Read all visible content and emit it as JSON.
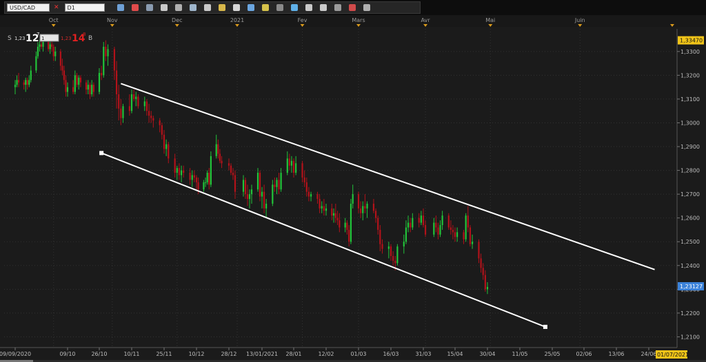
{
  "toolbar": {
    "symbol": "USD/CAD",
    "timeframe": "D1",
    "icon_names": [
      "close-icon",
      "x-icon",
      "bid-icon",
      "ask-icon",
      "cursor-icon",
      "crosshair-icon",
      "zoom-in-icon",
      "zoom-out-icon",
      "pan-icon",
      "point-icon",
      "text-icon",
      "eye-icon",
      "globe-icon",
      "pencil-icon",
      "chart-icon",
      "indicator-icon",
      "properties-icon",
      "template-icon",
      "alert-icon",
      "print-icon",
      "camera-icon",
      "export-icon",
      "settings-icon"
    ]
  },
  "trade_panel": {
    "sell_label": "S",
    "sell_price_small": "1,23",
    "sell_price_big": "12",
    "sell_price_sup": "7",
    "qty": "1",
    "buy_price_small": "1,23",
    "buy_price_big": "14",
    "buy_price_sup": "8",
    "buy_label": "B"
  },
  "colors": {
    "bull": "#22c43a",
    "bear": "#b3121a",
    "background": "#1b1b1b",
    "trendline": "#ffffff",
    "price_tag_current": "#3b82d9",
    "price_tag_top": "#f0c419"
  },
  "chart_data": {
    "type": "candlestick",
    "symbol": "USD/CAD",
    "timeframe": "D1",
    "y_range": [
      1.2055,
      1.3395
    ],
    "y_ticks": [
      "1,3300",
      "1,3200",
      "1,3100",
      "1,3000",
      "1,2900",
      "1,2800",
      "1,2700",
      "1,2600",
      "1,2500",
      "1,2400",
      "1,2300",
      "1,2200",
      "1,2100"
    ],
    "y_tick_values": [
      1.33,
      1.32,
      1.31,
      1.3,
      1.29,
      1.28,
      1.27,
      1.26,
      1.25,
      1.24,
      1.23,
      1.22,
      1.21
    ],
    "top_price_label": "1,33470",
    "top_price_value": 1.3347,
    "current_price_label": "1,23127",
    "current_price_value": 1.23127,
    "start_date": "09/09/2020",
    "end_date_label": "01/07/2021",
    "x_labels": [
      "09/09/2020",
      "09/10",
      "26/10",
      "10/11",
      "25/11",
      "10/12",
      "28/12",
      "13/01/2021",
      "28/01",
      "12/02",
      "01/03",
      "16/03",
      "31/03",
      "15/04",
      "30/04",
      "11/05",
      "25/05",
      "02/06",
      "13/06",
      "24/06"
    ],
    "x_label_dates": [
      "2020-09-09",
      "2020-10-09",
      "2020-10-26",
      "2020-11-10",
      "2020-11-25",
      "2020-12-10",
      "2020-12-28",
      "2021-01-13",
      "2021-01-28",
      "2021-02-12",
      "2021-03-01",
      "2021-03-16",
      "2021-03-31",
      "2021-04-15",
      "2021-04-30",
      "2021-05-11",
      "2021-05-25",
      "2021-06-02",
      "2021-06-13",
      "2021-06-24"
    ],
    "months": [
      "Oct",
      "Nov",
      "Dec",
      "2021",
      "Fev",
      "Mars",
      "Avr",
      "Mai",
      "Juin"
    ],
    "month_dates": [
      "2020-10-01",
      "2020-11-01",
      "2020-12-01",
      "2021-01-01",
      "2021-02-01",
      "2021-03-01",
      "2021-04-01",
      "2021-05-01",
      "2021-06-01"
    ],
    "candles": [
      [
        "2020-09-09",
        1.315,
        1.318,
        1.312,
        1.316
      ],
      [
        "2020-09-10",
        1.316,
        1.32,
        1.315,
        1.318
      ],
      [
        "2020-09-11",
        1.318,
        1.321,
        1.315,
        1.317
      ],
      [
        "2020-09-14",
        1.317,
        1.318,
        1.314,
        1.316
      ],
      [
        "2020-09-15",
        1.316,
        1.319,
        1.313,
        1.318
      ],
      [
        "2020-09-16",
        1.318,
        1.319,
        1.314,
        1.316
      ],
      [
        "2020-09-17",
        1.316,
        1.32,
        1.315,
        1.318
      ],
      [
        "2020-09-18",
        1.318,
        1.324,
        1.317,
        1.322
      ],
      [
        "2020-09-21",
        1.322,
        1.33,
        1.321,
        1.328
      ],
      [
        "2020-09-22",
        1.328,
        1.334,
        1.327,
        1.332
      ],
      [
        "2020-09-23",
        1.332,
        1.335,
        1.33,
        1.333
      ],
      [
        "2020-09-24",
        1.333,
        1.336,
        1.331,
        1.332
      ],
      [
        "2020-09-25",
        1.332,
        1.335,
        1.33,
        1.334
      ],
      [
        "2020-09-28",
        1.334,
        1.336,
        1.33,
        1.331
      ],
      [
        "2020-09-29",
        1.331,
        1.334,
        1.329,
        1.333
      ],
      [
        "2020-09-30",
        1.333,
        1.334,
        1.33,
        1.332
      ],
      [
        "2020-10-01",
        1.332,
        1.333,
        1.326,
        1.328
      ],
      [
        "2020-10-02",
        1.328,
        1.332,
        1.326,
        1.33
      ],
      [
        "2020-10-05",
        1.33,
        1.331,
        1.322,
        1.324
      ],
      [
        "2020-10-06",
        1.324,
        1.327,
        1.32,
        1.322
      ],
      [
        "2020-10-07",
        1.322,
        1.324,
        1.316,
        1.318
      ],
      [
        "2020-10-08",
        1.318,
        1.32,
        1.311,
        1.313
      ],
      [
        "2020-10-09",
        1.313,
        1.317,
        1.311,
        1.315
      ],
      [
        "2020-10-12",
        1.315,
        1.318,
        1.312,
        1.313
      ],
      [
        "2020-10-13",
        1.313,
        1.322,
        1.312,
        1.32
      ],
      [
        "2020-10-14",
        1.32,
        1.321,
        1.315,
        1.316
      ],
      [
        "2020-10-15",
        1.316,
        1.32,
        1.314,
        1.319
      ],
      [
        "2020-10-16",
        1.319,
        1.32,
        1.315,
        1.317
      ],
      [
        "2020-10-19",
        1.317,
        1.318,
        1.312,
        1.314
      ],
      [
        "2020-10-20",
        1.314,
        1.318,
        1.312,
        1.316
      ],
      [
        "2020-10-21",
        1.316,
        1.317,
        1.31,
        1.312
      ],
      [
        "2020-10-22",
        1.312,
        1.318,
        1.311,
        1.316
      ],
      [
        "2020-10-23",
        1.316,
        1.317,
        1.311,
        1.313
      ],
      [
        "2020-10-26",
        1.313,
        1.323,
        1.312,
        1.321
      ],
      [
        "2020-10-27",
        1.321,
        1.324,
        1.318,
        1.32
      ],
      [
        "2020-10-28",
        1.32,
        1.334,
        1.319,
        1.332
      ],
      [
        "2020-10-29",
        1.332,
        1.3347,
        1.326,
        1.328
      ],
      [
        "2020-10-30",
        1.328,
        1.333,
        1.324,
        1.331
      ],
      [
        "2020-11-02",
        1.331,
        1.332,
        1.318,
        1.322
      ],
      [
        "2020-11-03",
        1.322,
        1.326,
        1.306,
        1.312
      ],
      [
        "2020-11-04",
        1.312,
        1.316,
        1.301,
        1.306
      ],
      [
        "2020-11-05",
        1.306,
        1.31,
        1.299,
        1.302
      ],
      [
        "2020-11-06",
        1.302,
        1.308,
        1.3,
        1.307
      ],
      [
        "2020-11-09",
        1.307,
        1.312,
        1.303,
        1.305
      ],
      [
        "2020-11-10",
        1.305,
        1.314,
        1.304,
        1.312
      ],
      [
        "2020-11-11",
        1.312,
        1.314,
        1.309,
        1.31
      ],
      [
        "2020-11-12",
        1.31,
        1.313,
        1.307,
        1.311
      ],
      [
        "2020-11-13",
        1.311,
        1.312,
        1.306,
        1.307
      ],
      [
        "2020-11-16",
        1.307,
        1.311,
        1.305,
        1.309
      ],
      [
        "2020-11-17",
        1.309,
        1.31,
        1.303,
        1.305
      ],
      [
        "2020-11-18",
        1.305,
        1.308,
        1.3,
        1.303
      ],
      [
        "2020-11-19",
        1.303,
        1.305,
        1.3,
        1.302
      ],
      [
        "2020-11-20",
        1.302,
        1.303,
        1.298,
        1.301
      ],
      [
        "2020-11-23",
        1.301,
        1.302,
        1.296,
        1.299
      ],
      [
        "2020-11-24",
        1.299,
        1.3,
        1.293,
        1.295
      ],
      [
        "2020-11-25",
        1.295,
        1.297,
        1.287,
        1.289
      ],
      [
        "2020-11-26",
        1.289,
        1.293,
        1.286,
        1.291
      ],
      [
        "2020-11-27",
        1.291,
        1.292,
        1.283,
        1.285
      ],
      [
        "2020-11-30",
        1.285,
        1.287,
        1.277,
        1.279
      ],
      [
        "2020-12-01",
        1.279,
        1.282,
        1.276,
        1.281
      ],
      [
        "2020-12-02",
        1.281,
        1.283,
        1.276,
        1.278
      ],
      [
        "2020-12-03",
        1.278,
        1.282,
        1.275,
        1.28
      ],
      [
        "2020-12-04",
        1.28,
        1.282,
        1.277,
        1.279
      ],
      [
        "2020-12-07",
        1.279,
        1.281,
        1.274,
        1.276
      ],
      [
        "2020-12-08",
        1.276,
        1.28,
        1.273,
        1.278
      ],
      [
        "2020-12-09",
        1.278,
        1.28,
        1.275,
        1.277
      ],
      [
        "2020-12-10",
        1.277,
        1.278,
        1.272,
        1.275
      ],
      [
        "2020-12-11",
        1.275,
        1.277,
        1.27,
        1.272
      ],
      [
        "2020-12-14",
        1.272,
        1.276,
        1.271,
        1.275
      ],
      [
        "2020-12-15",
        1.275,
        1.277,
        1.273,
        1.275
      ],
      [
        "2020-12-16",
        1.275,
        1.28,
        1.274,
        1.279
      ],
      [
        "2020-12-17",
        1.279,
        1.281,
        1.272,
        1.274
      ],
      [
        "2020-12-18",
        1.274,
        1.288,
        1.273,
        1.286
      ],
      [
        "2020-12-21",
        1.286,
        1.295,
        1.285,
        1.291
      ],
      [
        "2020-12-22",
        1.291,
        1.293,
        1.285,
        1.287
      ],
      [
        "2020-12-23",
        1.287,
        1.289,
        1.283,
        1.284
      ],
      [
        "2020-12-24",
        1.284,
        1.286,
        1.281,
        1.283
      ],
      [
        "2020-12-28",
        1.283,
        1.285,
        1.28,
        1.282
      ],
      [
        "2020-12-29",
        1.282,
        1.283,
        1.278,
        1.279
      ],
      [
        "2020-12-30",
        1.279,
        1.281,
        1.276,
        1.278
      ],
      [
        "2020-12-31",
        1.278,
        1.28,
        1.268,
        1.271
      ],
      [
        "2021-01-04",
        1.271,
        1.278,
        1.269,
        1.276
      ],
      [
        "2021-01-05",
        1.276,
        1.277,
        1.268,
        1.27
      ],
      [
        "2021-01-06",
        1.27,
        1.274,
        1.265,
        1.268
      ],
      [
        "2021-01-07",
        1.268,
        1.272,
        1.264,
        1.27
      ],
      [
        "2021-01-08",
        1.27,
        1.274,
        1.266,
        1.272
      ],
      [
        "2021-01-11",
        1.272,
        1.281,
        1.271,
        1.279
      ],
      [
        "2021-01-12",
        1.279,
        1.28,
        1.267,
        1.269
      ],
      [
        "2021-01-13",
        1.269,
        1.273,
        1.264,
        1.271
      ],
      [
        "2021-01-14",
        1.271,
        1.274,
        1.262,
        1.264
      ],
      [
        "2021-01-15",
        1.264,
        1.268,
        1.26,
        1.266
      ],
      [
        "2021-01-18",
        1.266,
        1.276,
        1.265,
        1.274
      ],
      [
        "2021-01-19",
        1.274,
        1.277,
        1.271,
        1.273
      ],
      [
        "2021-01-20",
        1.273,
        1.277,
        1.27,
        1.276
      ],
      [
        "2021-01-21",
        1.276,
        1.279,
        1.27,
        1.272
      ],
      [
        "2021-01-22",
        1.272,
        1.281,
        1.271,
        1.279
      ],
      [
        "2021-01-25",
        1.279,
        1.288,
        1.278,
        1.285
      ],
      [
        "2021-01-26",
        1.285,
        1.287,
        1.28,
        1.282
      ],
      [
        "2021-01-27",
        1.282,
        1.286,
        1.279,
        1.284
      ],
      [
        "2021-01-28",
        1.284,
        1.285,
        1.277,
        1.279
      ],
      [
        "2021-01-29",
        1.279,
        1.286,
        1.278,
        1.283
      ],
      [
        "2021-02-01",
        1.283,
        1.284,
        1.275,
        1.277
      ],
      [
        "2021-02-02",
        1.277,
        1.28,
        1.273,
        1.275
      ],
      [
        "2021-02-03",
        1.275,
        1.277,
        1.269,
        1.271
      ],
      [
        "2021-02-04",
        1.271,
        1.273,
        1.267,
        1.269
      ],
      [
        "2021-02-05",
        1.269,
        1.271,
        1.267,
        1.27
      ],
      [
        "2021-02-08",
        1.27,
        1.271,
        1.266,
        1.268
      ],
      [
        "2021-02-09",
        1.268,
        1.27,
        1.262,
        1.264
      ],
      [
        "2021-02-10",
        1.264,
        1.267,
        1.262,
        1.265
      ],
      [
        "2021-02-11",
        1.265,
        1.268,
        1.261,
        1.263
      ],
      [
        "2021-02-12",
        1.263,
        1.266,
        1.261,
        1.264
      ],
      [
        "2021-02-15",
        1.264,
        1.266,
        1.259,
        1.261
      ],
      [
        "2021-02-16",
        1.261,
        1.264,
        1.258,
        1.262
      ],
      [
        "2021-02-17",
        1.262,
        1.266,
        1.258,
        1.26
      ],
      [
        "2021-02-18",
        1.26,
        1.263,
        1.257,
        1.259
      ],
      [
        "2021-02-19",
        1.259,
        1.262,
        1.254,
        1.256
      ],
      [
        "2021-02-22",
        1.256,
        1.26,
        1.254,
        1.258
      ],
      [
        "2021-02-23",
        1.258,
        1.259,
        1.253,
        1.255
      ],
      [
        "2021-02-24",
        1.255,
        1.257,
        1.248,
        1.25
      ],
      [
        "2021-02-25",
        1.25,
        1.268,
        1.249,
        1.266
      ],
      [
        "2021-02-26",
        1.266,
        1.274,
        1.264,
        1.27
      ],
      [
        "2021-03-01",
        1.27,
        1.271,
        1.262,
        1.264
      ],
      [
        "2021-03-02",
        1.264,
        1.267,
        1.26,
        1.262
      ],
      [
        "2021-03-03",
        1.262,
        1.267,
        1.259,
        1.265
      ],
      [
        "2021-03-04",
        1.265,
        1.27,
        1.262,
        1.264
      ],
      [
        "2021-03-05",
        1.264,
        1.267,
        1.26,
        1.266
      ],
      [
        "2021-03-08",
        1.266,
        1.268,
        1.262,
        1.263
      ],
      [
        "2021-03-09",
        1.263,
        1.264,
        1.258,
        1.26
      ],
      [
        "2021-03-10",
        1.26,
        1.261,
        1.253,
        1.255
      ],
      [
        "2021-03-11",
        1.255,
        1.257,
        1.246,
        1.249
      ],
      [
        "2021-03-12",
        1.249,
        1.251,
        1.245,
        1.247
      ],
      [
        "2021-03-15",
        1.247,
        1.25,
        1.243,
        1.248
      ],
      [
        "2021-03-16",
        1.248,
        1.249,
        1.242,
        1.244
      ],
      [
        "2021-03-17",
        1.244,
        1.246,
        1.24,
        1.242
      ],
      [
        "2021-03-18",
        1.242,
        1.244,
        1.238,
        1.241
      ],
      [
        "2021-03-19",
        1.241,
        1.249,
        1.24,
        1.248
      ],
      [
        "2021-03-22",
        1.248,
        1.253,
        1.245,
        1.25
      ],
      [
        "2021-03-23",
        1.25,
        1.259,
        1.249,
        1.256
      ],
      [
        "2021-03-24",
        1.256,
        1.261,
        1.254,
        1.258
      ],
      [
        "2021-03-25",
        1.258,
        1.26,
        1.254,
        1.256
      ],
      [
        "2021-03-26",
        1.256,
        1.262,
        1.255,
        1.26
      ],
      [
        "2021-03-29",
        1.26,
        1.262,
        1.256,
        1.258
      ],
      [
        "2021-03-30",
        1.258,
        1.263,
        1.257,
        1.261
      ],
      [
        "2021-03-31",
        1.261,
        1.264,
        1.256,
        1.257
      ],
      [
        "2021-04-01",
        1.257,
        1.259,
        1.252,
        1.253
      ],
      [
        "2021-04-05",
        1.253,
        1.26,
        1.252,
        1.258
      ],
      [
        "2021-04-06",
        1.258,
        1.261,
        1.254,
        1.256
      ],
      [
        "2021-04-07",
        1.256,
        1.258,
        1.251,
        1.253
      ],
      [
        "2021-04-08",
        1.253,
        1.259,
        1.252,
        1.257
      ],
      [
        "2021-04-09",
        1.257,
        1.263,
        1.255,
        1.261
      ],
      [
        "2021-04-12",
        1.261,
        1.262,
        1.255,
        1.256
      ],
      [
        "2021-04-13",
        1.256,
        1.259,
        1.253,
        1.255
      ],
      [
        "2021-04-14",
        1.255,
        1.257,
        1.251,
        1.254
      ],
      [
        "2021-04-15",
        1.254,
        1.256,
        1.25,
        1.252
      ],
      [
        "2021-04-16",
        1.252,
        1.256,
        1.25,
        1.254
      ],
      [
        "2021-04-19",
        1.254,
        1.255,
        1.249,
        1.251
      ],
      [
        "2021-04-20",
        1.251,
        1.262,
        1.25,
        1.261
      ],
      [
        "2021-04-21",
        1.261,
        1.265,
        1.254,
        1.256
      ],
      [
        "2021-04-22",
        1.256,
        1.257,
        1.248,
        1.249
      ],
      [
        "2021-04-23",
        1.249,
        1.253,
        1.247,
        1.25
      ],
      [
        "2021-04-26",
        1.25,
        1.251,
        1.241,
        1.243
      ],
      [
        "2021-04-27",
        1.243,
        1.245,
        1.237,
        1.239
      ],
      [
        "2021-04-28",
        1.239,
        1.241,
        1.234,
        1.236
      ],
      [
        "2021-04-29",
        1.236,
        1.238,
        1.229,
        1.23
      ],
      [
        "2021-04-30",
        1.23,
        1.233,
        1.228,
        1.231
      ]
    ],
    "trendlines": [
      {
        "name": "upper-channel-line",
        "start": [
          "2020-11-05",
          1.3165
        ],
        "end": [
          "2021-06-26",
          1.2383
        ]
      },
      {
        "name": "lower-channel-line",
        "start": [
          "2020-10-27",
          1.2873
        ],
        "end": [
          "2021-05-22",
          1.2142
        ]
      }
    ],
    "grid": true
  }
}
